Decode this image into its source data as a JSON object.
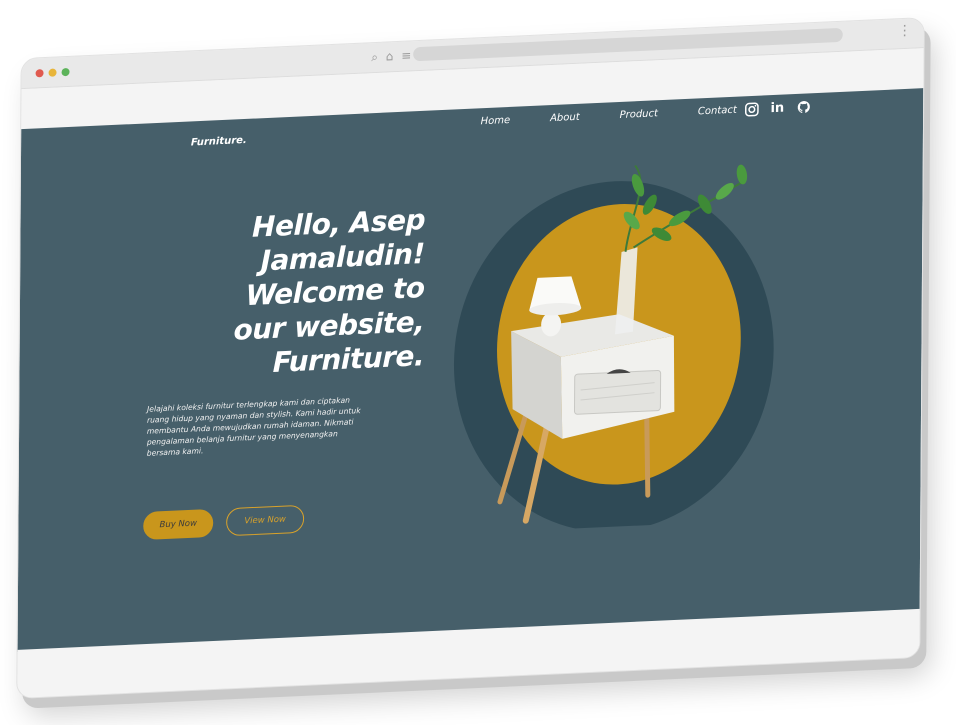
{
  "browser": {
    "window_dots": [
      "red",
      "yellow",
      "green"
    ],
    "address_icons": [
      "search-icon",
      "home-icon",
      "site-info-icon"
    ]
  },
  "site": {
    "logo": "Furniture.",
    "nav": [
      "Home",
      "About",
      "Product",
      "Contact"
    ],
    "socials": [
      "instagram-icon",
      "linkedin-icon",
      "github-icon"
    ]
  },
  "hero": {
    "title_lines": [
      "Hello, Asep",
      "Jamaludin!",
      "Welcome to",
      "our website,",
      "Furniture."
    ],
    "description": "Jelajahi koleksi furnitur terlengkap kami dan ciptakan ruang hidup yang nyaman dan stylish. Kami hadir untuk membantu Anda mewujudkan rumah idaman. Nikmati pengalaman belanja furnitur yang menyenangkan bersama kami.",
    "buttons": {
      "buy": "Buy Now",
      "view": "View Now"
    }
  },
  "colors": {
    "page_bg": "#465f6a",
    "accent": "#c9961c",
    "circle_dark": "#2f4a56",
    "frame": "#f3f3f3"
  }
}
